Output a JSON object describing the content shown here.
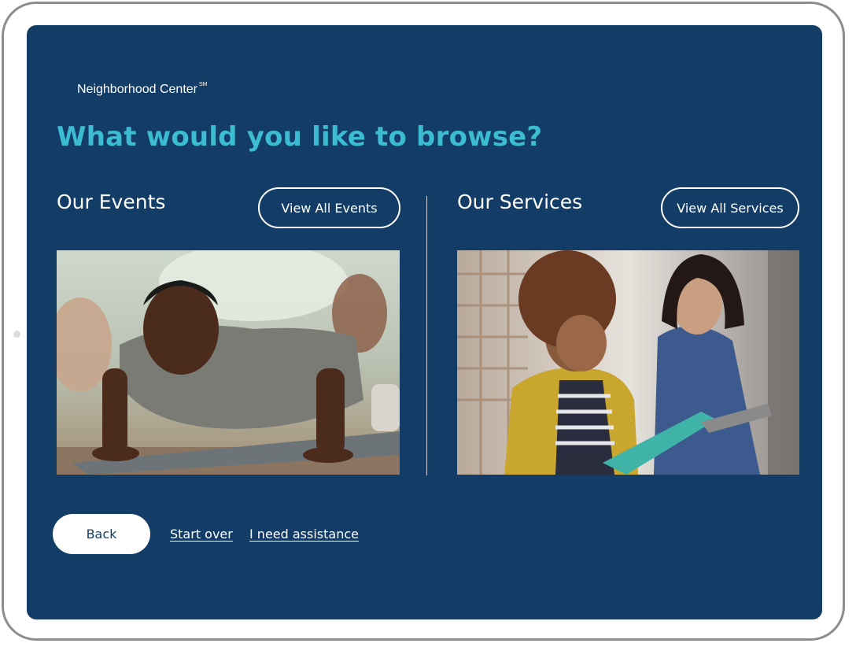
{
  "brand": {
    "name": "Neighborhood Center",
    "mark": "SM"
  },
  "page": {
    "title": "What would you like to browse?"
  },
  "events": {
    "heading": "Our Events",
    "view_all_label": "View All Events"
  },
  "services": {
    "heading": "Our Services",
    "view_all_label": "View All Services"
  },
  "footer": {
    "back_label": "Back",
    "start_over_label": "Start over",
    "assistance_label": "I need assistance"
  },
  "colors": {
    "screen_background": "#133d67",
    "title_accent": "#3cbcd0",
    "text": "#ffffff"
  }
}
